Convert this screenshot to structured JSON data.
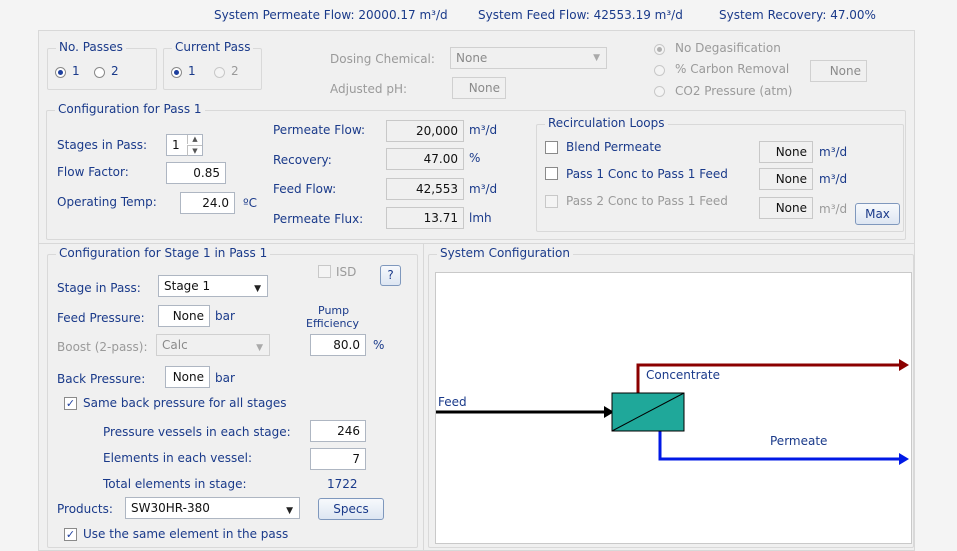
{
  "header": {
    "permeate_flow": "System Permeate Flow: 20000.17 m³/d",
    "feed_flow": "System Feed Flow: 42553.19 m³/d",
    "recovery": "System Recovery: 47.00%"
  },
  "passes": {
    "title": "No. Passes",
    "options": [
      "1",
      "2"
    ],
    "selected": "1"
  },
  "current_pass": {
    "title": "Current Pass",
    "options": [
      "1",
      "2"
    ],
    "selected": "1"
  },
  "dosing": {
    "label": "Dosing Chemical:",
    "value": "None",
    "adjusted_ph_label": "Adjusted pH:",
    "adjusted_ph_value": "None"
  },
  "degas": {
    "options": [
      "No Degasification",
      "% Carbon Removal",
      "CO2 Pressure (atm)"
    ],
    "selected": "No Degasification",
    "value": "None"
  },
  "pass_config": {
    "title": "Configuration for Pass 1",
    "stages_label": "Stages in Pass:",
    "stages_value": "1",
    "flow_factor_label": "Flow Factor:",
    "flow_factor_value": "0.85",
    "temp_label": "Operating Temp:",
    "temp_value": "24.0",
    "temp_unit": "ºC",
    "permeate_flow_label": "Permeate Flow:",
    "permeate_flow_value": "20,000",
    "permeate_flow_unit": "m³/d",
    "recovery_label": "Recovery:",
    "recovery_value": "47.00",
    "recovery_unit": "%",
    "feed_flow_label": "Feed Flow:",
    "feed_flow_value": "42,553",
    "feed_flow_unit": "m³/d",
    "flux_label": "Permeate Flux:",
    "flux_value": "13.71",
    "flux_unit": "lmh"
  },
  "recirc": {
    "title": "Recirculation Loops",
    "items": [
      {
        "label": "Blend Permeate",
        "value": "None",
        "unit": "m³/d",
        "checked": false,
        "enabled": true
      },
      {
        "label": "Pass 1 Conc to Pass 1 Feed",
        "value": "None",
        "unit": "m³/d",
        "checked": false,
        "enabled": true
      },
      {
        "label": "Pass 2 Conc to Pass 1 Feed",
        "value": "None",
        "unit": "m³/d",
        "checked": false,
        "enabled": false
      }
    ],
    "max_label": "Max"
  },
  "stage_config": {
    "title": "Configuration for Stage 1 in Pass 1",
    "stage_label": "Stage in Pass:",
    "stage_value": "Stage 1",
    "isd_label": "ISD",
    "help_label": "?",
    "feed_pressure_label": "Feed Pressure:",
    "feed_pressure_value": "None",
    "feed_pressure_unit": "bar",
    "pump_eff_label_1": "Pump",
    "pump_eff_label_2": "Efficiency",
    "pump_eff_value": "80.0",
    "pump_eff_unit": "%",
    "boost_label": "Boost (2-pass):",
    "boost_value": "Calc",
    "back_pressure_label": "Back Pressure:",
    "back_pressure_value": "None",
    "back_pressure_unit": "bar",
    "same_back_label": "Same back pressure for all stages",
    "same_back_checked": true,
    "vessels_label": "Pressure vessels in each stage:",
    "vessels_value": "246",
    "elements_label": "Elements in each vessel:",
    "elements_value": "7",
    "total_label": "Total elements in stage:",
    "total_value": "1722",
    "products_label": "Products:",
    "products_value": "SW30HR-380",
    "specs_label": "Specs",
    "same_element_label": "Use the same element in the pass",
    "same_element_checked": true
  },
  "system_config": {
    "title": "System Configuration",
    "feed_label": "Feed",
    "concentrate_label": "Concentrate",
    "permeate_label": "Permeate",
    "colors": {
      "feed": "#000000",
      "concentrate": "#8b0000",
      "permeate": "#0019e6",
      "vessel": "#1fa89a"
    }
  }
}
